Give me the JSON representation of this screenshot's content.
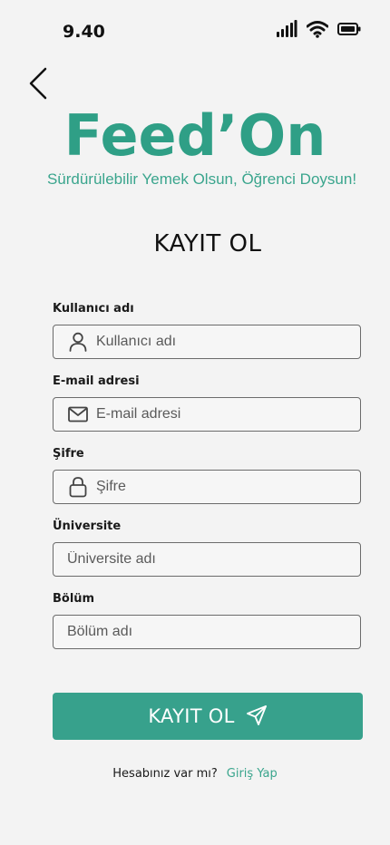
{
  "status_bar": {
    "time": "9.40",
    "icons": [
      "signal-icon",
      "wifi-icon",
      "battery-icon"
    ]
  },
  "header": {
    "back_icon": "chevron-left-icon",
    "brand": "Feed’On",
    "tagline": "Sürdürülebilir Yemek Olsun, Öğrenci Doysun!",
    "title": "KAYIT OL"
  },
  "form": {
    "username": {
      "label": "Kullanıcı adı",
      "placeholder": "Kullanıcı adı",
      "icon": "user-icon"
    },
    "email": {
      "label": "E-mail adresi",
      "placeholder": "E-mail adresi",
      "icon": "mail-icon"
    },
    "password": {
      "label": "Şifre",
      "placeholder": "Şifre",
      "icon": "lock-icon"
    },
    "university": {
      "label": "Üniversite",
      "placeholder": "Üniversite adı"
    },
    "department": {
      "label": "Bölüm",
      "placeholder": "Bölüm adı"
    },
    "submit_label": "KAYIT OL",
    "submit_icon": "send-icon"
  },
  "footer": {
    "question": "Hesabınız var mı?",
    "link": "Giriş Yap"
  },
  "colors": {
    "accent": "#37a18c",
    "background": "#f3f3f3",
    "text": "#111111"
  }
}
